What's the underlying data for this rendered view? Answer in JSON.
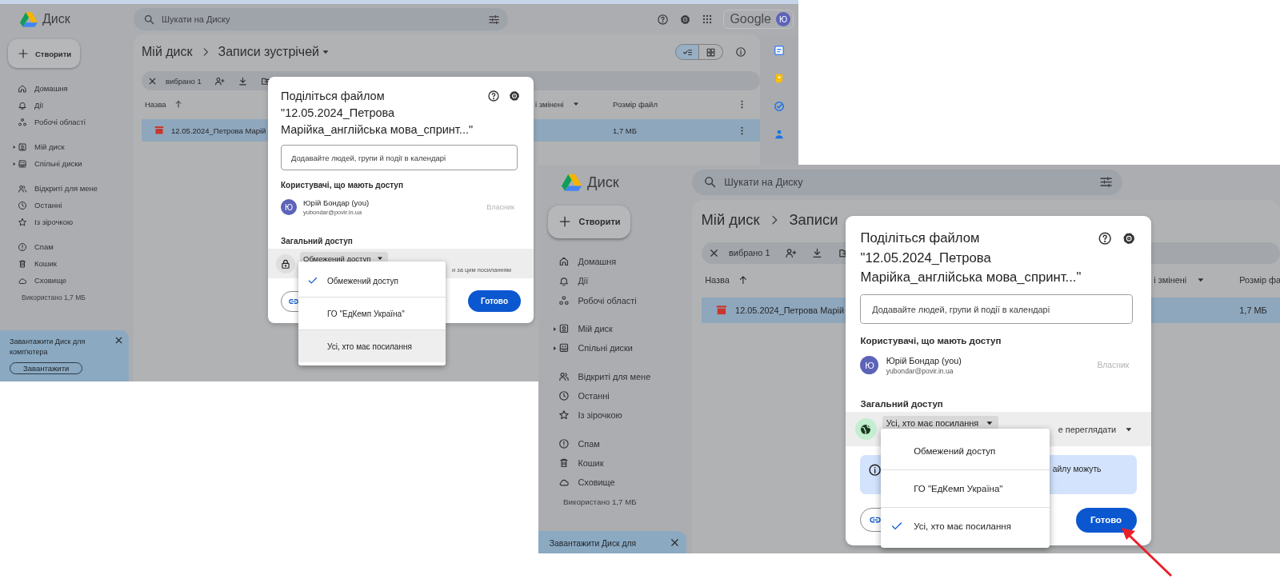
{
  "screenshots": [
    {
      "app_name": "Диск",
      "search": {
        "placeholder": "Шукати на Диску"
      },
      "account": {
        "brand": "Google",
        "avatar": "Ю"
      },
      "create_button": "Створити",
      "nav_groups": [
        [
          {
            "label": "Домашня",
            "expandable": false
          },
          {
            "label": "Дії",
            "expandable": false
          },
          {
            "label": "Робочі області",
            "expandable": false
          }
        ],
        [
          {
            "label": "Мій диск",
            "expandable": true
          },
          {
            "label": "Спільні диски",
            "expandable": true
          }
        ],
        [
          {
            "label": "Відкриті для мене",
            "expandable": false
          },
          {
            "label": "Останні",
            "expandable": false
          },
          {
            "label": "Із зірочкою",
            "expandable": false
          }
        ],
        [
          {
            "label": "Спам",
            "expandable": false
          },
          {
            "label": "Кошик",
            "expandable": false
          },
          {
            "label": "Сховище",
            "expandable": false
          }
        ]
      ],
      "storage": "Використано 1,7 МБ",
      "banner": {
        "text": "Завантажити Диск для комп'ютера",
        "button": "Завантажити"
      },
      "breadcrumb": [
        "Мій диск",
        "Записи зустрічей"
      ],
      "folder_menu": true,
      "view_options": [
        {
          "selected": true
        },
        {
          "selected": false
        }
      ],
      "selection": "вибрано 1",
      "columns": [
        "Назва",
        "і змінені",
        "Розмір файл"
      ],
      "column_menu": true,
      "rows": [
        {
          "name": "12.05.2024_Петрова Марій",
          "size": "1,7 МБ",
          "selected": true,
          "menu": true
        }
      ],
      "side_panel": true,
      "dialog": {
        "title": "Поділіться файлом \"12.05.2024_Петрова Марійка_англійська мова_спринт...\"",
        "input_placeholder": "Додавайте людей, групи й події в календарі",
        "people_heading": "Користувачі, що мають доступ",
        "people": [
          {
            "avatar": "Ю",
            "name": "Юрій Бондар (you)",
            "email": "yubondar@povir.in.ua",
            "role": "Власник"
          }
        ],
        "general_heading": "Загальний доступ",
        "access": {
          "kind": "restricted",
          "value": "Обмежений доступ",
          "detail": "и за цим посиланням"
        },
        "done_button": "Готово",
        "menu": [
          {
            "label": "Обмежений доступ",
            "selected": true,
            "hovered": false
          },
          {
            "label": "ГО \"ЕдКемп Україна\"",
            "selected": false,
            "hovered": false
          },
          {
            "label": "Усі, хто має посилання",
            "selected": false,
            "hovered": true
          }
        ]
      }
    },
    {
      "app_name": "Диск",
      "search": {
        "placeholder": "Шукати на Диску"
      },
      "create_button": "Створити",
      "nav_groups": [
        [
          {
            "label": "Домашня",
            "expandable": false
          },
          {
            "label": "Дії",
            "expandable": false
          },
          {
            "label": "Робочі області",
            "expandable": false
          }
        ],
        [
          {
            "label": "Мій диск",
            "expandable": true
          },
          {
            "label": "Спільні диски",
            "expandable": true
          }
        ],
        [
          {
            "label": "Відкриті для мене",
            "expandable": false
          },
          {
            "label": "Останні",
            "expandable": false
          },
          {
            "label": "Із зірочкою",
            "expandable": false
          }
        ],
        [
          {
            "label": "Спам",
            "expandable": false
          },
          {
            "label": "Кошик",
            "expandable": false
          },
          {
            "label": "Сховище",
            "expandable": false
          }
        ]
      ],
      "storage": "Використано 1,7 МБ",
      "banner": {
        "text": "Завантажити Диск для"
      },
      "breadcrumb": [
        "Мій диск",
        "Записи"
      ],
      "folder_menu": false,
      "selection": "вибрано 1",
      "columns": [
        "Назва",
        "і змінені",
        "Розмір фа"
      ],
      "column_menu": false,
      "rows": [
        {
          "name": "12.05.2024_Петрова Марій",
          "size": "1,7 МБ",
          "selected": true,
          "menu": false
        }
      ],
      "side_panel": false,
      "dialog": {
        "title": "Поділіться файлом \"12.05.2024_Петрова Марійка_англійська мова_спринт...\"",
        "input_placeholder": "Додавайте людей, групи й події в календарі",
        "people_heading": "Користувачі, що мають доступ",
        "people": [
          {
            "avatar": "Ю",
            "name": "Юрій Бондар (you)",
            "email": "yubondar@povir.in.ua",
            "role": "Власник"
          }
        ],
        "general_heading": "Загальний доступ",
        "access": {
          "kind": "anyone",
          "value": "Усі, хто має посилання",
          "role": "е переглядати"
        },
        "notice": "айлу можуть",
        "done_button": "Готово",
        "menu": [
          {
            "label": "Обмежений доступ",
            "selected": false,
            "hovered": false
          },
          {
            "label": "ГО \"ЕдКемп Україна\"",
            "selected": false,
            "hovered": false
          },
          {
            "label": "Усі, хто має посилання",
            "selected": true,
            "hovered": false
          }
        ]
      }
    }
  ],
  "annotations": [
    {
      "kind": "arrow"
    }
  ]
}
